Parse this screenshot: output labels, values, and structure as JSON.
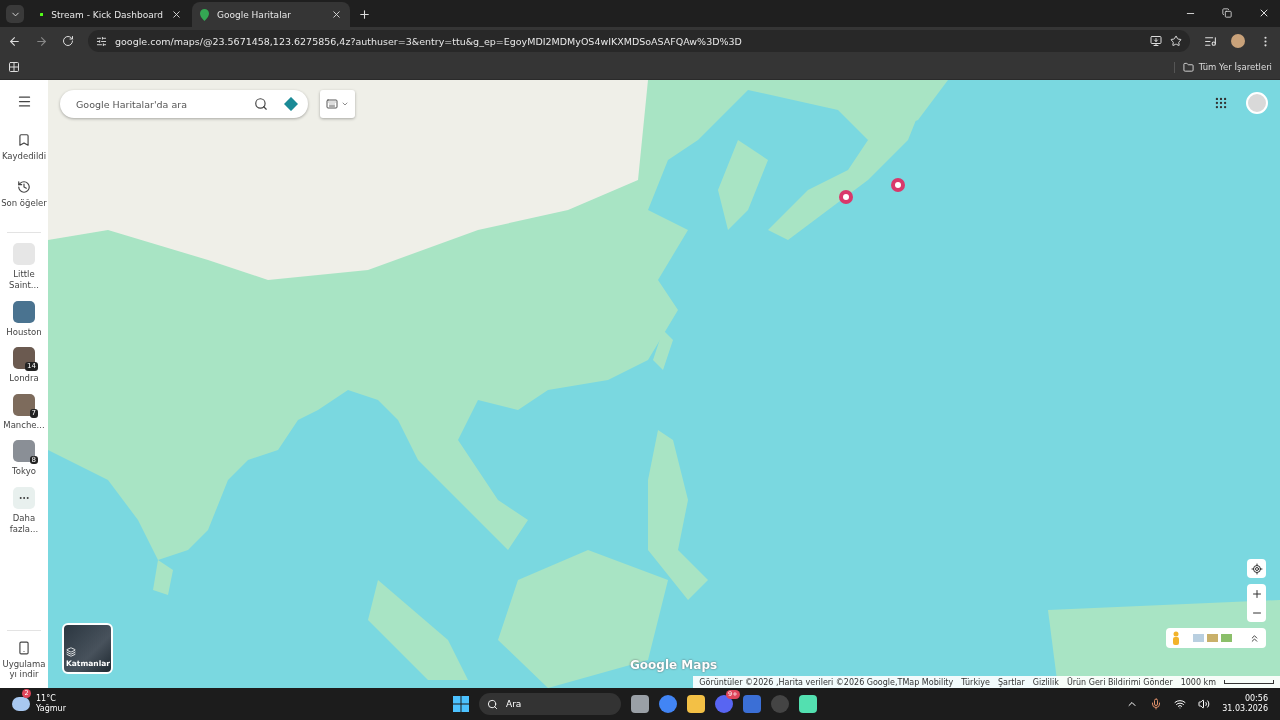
{
  "browser": {
    "tabs": [
      {
        "title": "Stream - Kick Dashboard",
        "selected": false,
        "kind": "kick"
      },
      {
        "title": "Google Haritalar",
        "selected": true,
        "kind": "maps"
      }
    ],
    "url": "google.com/maps/@23.5671458,123.6275856,4z?authuser=3&entry=ttu&g_ep=EgoyMDI2MDMyOS4wIKXMDSoASAFQAw%3D%3D",
    "bookmarks": "Tüm Yer İşaretleri"
  },
  "sidebar": {
    "top_items": [
      {
        "label": "Kaydedildi",
        "kind": "bookmark"
      },
      {
        "label": "Son öğeler",
        "kind": "history"
      }
    ],
    "places": [
      {
        "label": "Little Saint..."
      },
      {
        "label": "Houston"
      },
      {
        "label": "Londra",
        "count": "14"
      },
      {
        "label": "Manche...",
        "count": "7"
      },
      {
        "label": "Tokyo",
        "count": "8"
      }
    ],
    "more": "Daha fazla...",
    "download": "Uygulamayı indir"
  },
  "map": {
    "search": {
      "placeholder": "Google Haritalar'da ara"
    },
    "layers": "Katmanlar",
    "logo": "Google Maps",
    "attribution": [
      "Görüntüler ©2026 ,Harita verileri ©2026 Google,TMap Mobility",
      "Türkiye",
      "Şartlar",
      "Gizlilik",
      "Ürün Geri Bildirimi Gönder"
    ],
    "scale": "1000 km"
  },
  "taskbar": {
    "weather": {
      "temp": "11°C",
      "text": "Yağmur",
      "badge": "2"
    },
    "search": "Ara",
    "discord_badge": "9+",
    "time": "00:56",
    "date": "31.03.2026"
  }
}
